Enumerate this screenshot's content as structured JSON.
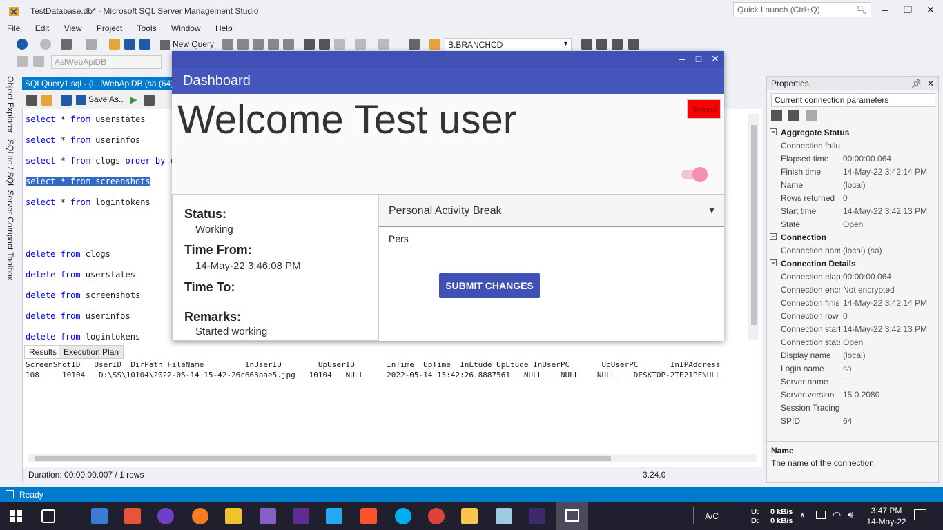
{
  "window": {
    "title": "TestDatabase.db* - Microsoft SQL Server Management Studio",
    "quick_launch_placeholder": "Quick Launch (Ctrl+Q)"
  },
  "menu": [
    "File",
    "Edit",
    "View",
    "Project",
    "Tools",
    "Window",
    "Help"
  ],
  "toolbar": {
    "new_query": "New Query",
    "branch_combo": "B.BRANCHCD",
    "db_combo": "AslWebApiDB",
    "save_as": "Save As.."
  },
  "left_rail": {
    "object_explorer": "Object Explorer",
    "toolbox": "SQLite / SQL Server Compact Toolbox"
  },
  "editor": {
    "tab_title": "SQLQuery1.sql - (l...lWebApiDB (sa (64))*",
    "lines": [
      {
        "kw1": "select",
        "rest": " * ",
        "kw2": "from",
        "tail": " userstates"
      },
      {
        "kw1": "select",
        "rest": " * ",
        "kw2": "from",
        "tail": " userinfos"
      },
      {
        "kw1": "select",
        "rest": " * ",
        "kw2": "from",
        "tail": " clogs ",
        "kw3": "order by",
        "tail2": " cl"
      },
      {
        "selected": "select * from screenshots"
      },
      {
        "kw1": "select",
        "rest": " * ",
        "kw2": "from",
        "tail": " logintokens"
      },
      {
        "kw1": "delete",
        "rest": " ",
        "kw2": "from",
        "tail": " clogs"
      },
      {
        "kw1": "delete",
        "rest": " ",
        "kw2": "from",
        "tail": " userstates"
      },
      {
        "kw1": "delete",
        "rest": " ",
        "kw2": "from",
        "tail": " screenshots"
      },
      {
        "kw1": "delete",
        "rest": " ",
        "kw2": "from",
        "tail": " userinfos"
      },
      {
        "kw1": "delete",
        "rest": " ",
        "kw2": "from",
        "tail": " logintokens"
      }
    ]
  },
  "results": {
    "tabs": [
      "Results",
      "Execution Plan"
    ],
    "header": "ScreenShotID   UserID  DirPath FileName         InUserID        UpUserID       InTime  UpTime  InLtude UpLtude InUserPC       UpUserPC       InIPAddress",
    "row": "108     10104   D:\\SS\\10104\\2022-05-14 15-42-26c663aae5.jpg   10104   NULL     2022-05-14 15:42:26.8887561   NULL    NULL    NULL    DESKTOP-2TE21PFNULL",
    "duration": "Duration: 00:00:00.007 / 1 rows",
    "version": "3.24.0"
  },
  "properties": {
    "title": "Properties",
    "combo": "Current connection parameters",
    "rows": [
      {
        "type": "cat",
        "k": "Aggregate Status"
      },
      {
        "k": "Connection failu",
        "v": ""
      },
      {
        "k": "Elapsed time",
        "v": "00:00:00.064"
      },
      {
        "k": "Finish time",
        "v": "14-May-22 3:42:14 PM"
      },
      {
        "k": "Name",
        "v": "(local)"
      },
      {
        "k": "Rows returned",
        "v": "0"
      },
      {
        "k": "Start time",
        "v": "14-May-22 3:42:13 PM"
      },
      {
        "k": "State",
        "v": "Open"
      },
      {
        "type": "cat",
        "k": "Connection"
      },
      {
        "k": "Connection nam",
        "v": "(local) (sa)"
      },
      {
        "type": "cat",
        "k": "Connection Details"
      },
      {
        "k": "Connection elap",
        "v": "00:00:00.064"
      },
      {
        "k": "Connection encr",
        "v": "Not encrypted"
      },
      {
        "k": "Connection finis",
        "v": "14-May-22 3:42:14 PM"
      },
      {
        "k": "Connection row",
        "v": "0"
      },
      {
        "k": "Connection start",
        "v": "14-May-22 3:42:13 PM"
      },
      {
        "k": "Connection state",
        "v": "Open"
      },
      {
        "k": "Display name",
        "v": "(local)"
      },
      {
        "k": "Login name",
        "v": "sa"
      },
      {
        "k": "Server name",
        "v": "."
      },
      {
        "k": "Server version",
        "v": "15.0.2080"
      },
      {
        "k": "Session Tracing I",
        "v": ""
      },
      {
        "k": "SPID",
        "v": "64"
      }
    ],
    "desc_title": "Name",
    "desc_text": "The name of the connection."
  },
  "status_bar": {
    "text": "Ready"
  },
  "dashboard": {
    "title": "Dashboard",
    "welcome": "Welcome Test user",
    "reload": "Reload",
    "status_label": "Status:",
    "status_value": "Working",
    "time_from_label": "Time From:",
    "time_from_value": "14-May-22 3:46:08 PM",
    "time_to_label": "Time To:",
    "remarks_label": "Remarks:",
    "remarks_value": "Started working",
    "activity_select": "Personal Activity Break",
    "remarks_input": "Pers",
    "submit": "SUBMIT CHANGES"
  },
  "taskbar": {
    "keyboard": "A/C",
    "net_up_label": "U:",
    "net_down_label": "D:",
    "net_up": "0 kB/s",
    "net_down": "0 kB/s",
    "time": "3:47 PM",
    "date": "14-May-22"
  },
  "colors": {
    "accent": "#007acc",
    "dashboard_primary": "#3f51b5",
    "reload": "#ff0000"
  }
}
